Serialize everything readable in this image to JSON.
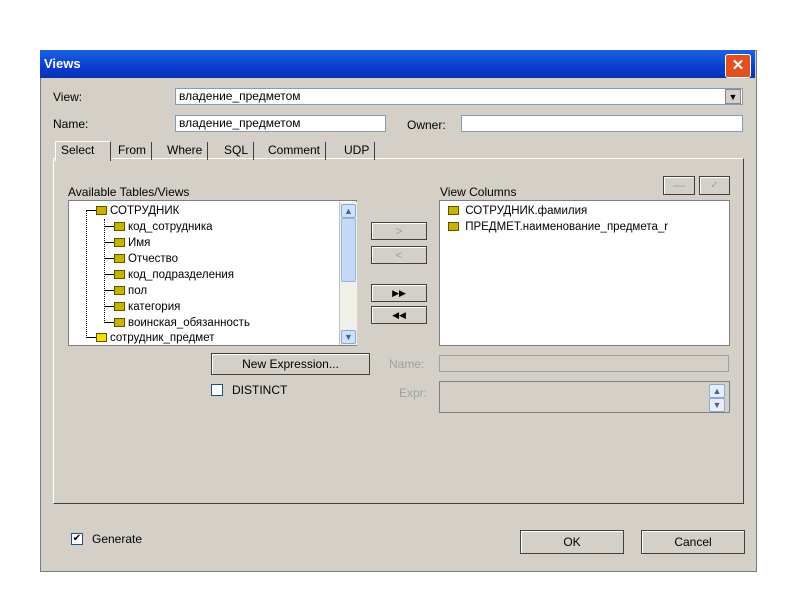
{
  "window": {
    "title": "Views",
    "close_glyph": "✕"
  },
  "view_row": {
    "label": "View:",
    "value": "владение_предметом",
    "arrow": "▼"
  },
  "name_row": {
    "label": "Name:",
    "value": "владение_предметом",
    "owner_label": "Owner:",
    "owner_value": ""
  },
  "tabs": [
    "Select",
    "From",
    "Where",
    "SQL",
    "Comment",
    "UDP"
  ],
  "available": {
    "label": "Available Tables/Views",
    "items": [
      {
        "text": "СОТРУДНИК",
        "level": 0
      },
      {
        "text": "код_сотрудника",
        "level": 1
      },
      {
        "text": "Имя",
        "level": 1
      },
      {
        "text": "Отчество",
        "level": 1
      },
      {
        "text": "код_подразделения",
        "level": 1
      },
      {
        "text": "пол",
        "level": 1
      },
      {
        "text": "категория",
        "level": 1
      },
      {
        "text": "воинская_обязанность",
        "level": 1
      },
      {
        "text": "сотрудник_предмет",
        "level": 0
      }
    ]
  },
  "transfer_buttons": {
    "add": ">",
    "remove": "<",
    "add_all": "▶▶",
    "remove_all": "◀◀"
  },
  "view_columns": {
    "label": "View Columns",
    "items": [
      "СОТРУДНИК.фамилия",
      "ПРЕДМЕТ.наименование_предмета_r"
    ]
  },
  "order_buttons": {
    "up": "—",
    "down": "✓"
  },
  "new_expression_label": "New Expression...",
  "expr_name": {
    "label": "Name:",
    "value": ""
  },
  "distinct": {
    "label": "DISTINCT",
    "checked": false
  },
  "expr": {
    "label": "Expr:",
    "value": ""
  },
  "generate": {
    "label": "Generate",
    "checked": true,
    "mark": "✔"
  },
  "ok_label": "OK",
  "cancel_label": "Cancel",
  "colors": {
    "title_bar": "#0a3ed0",
    "dialog_bg": "#d4d0c8",
    "close": "#e05020"
  }
}
